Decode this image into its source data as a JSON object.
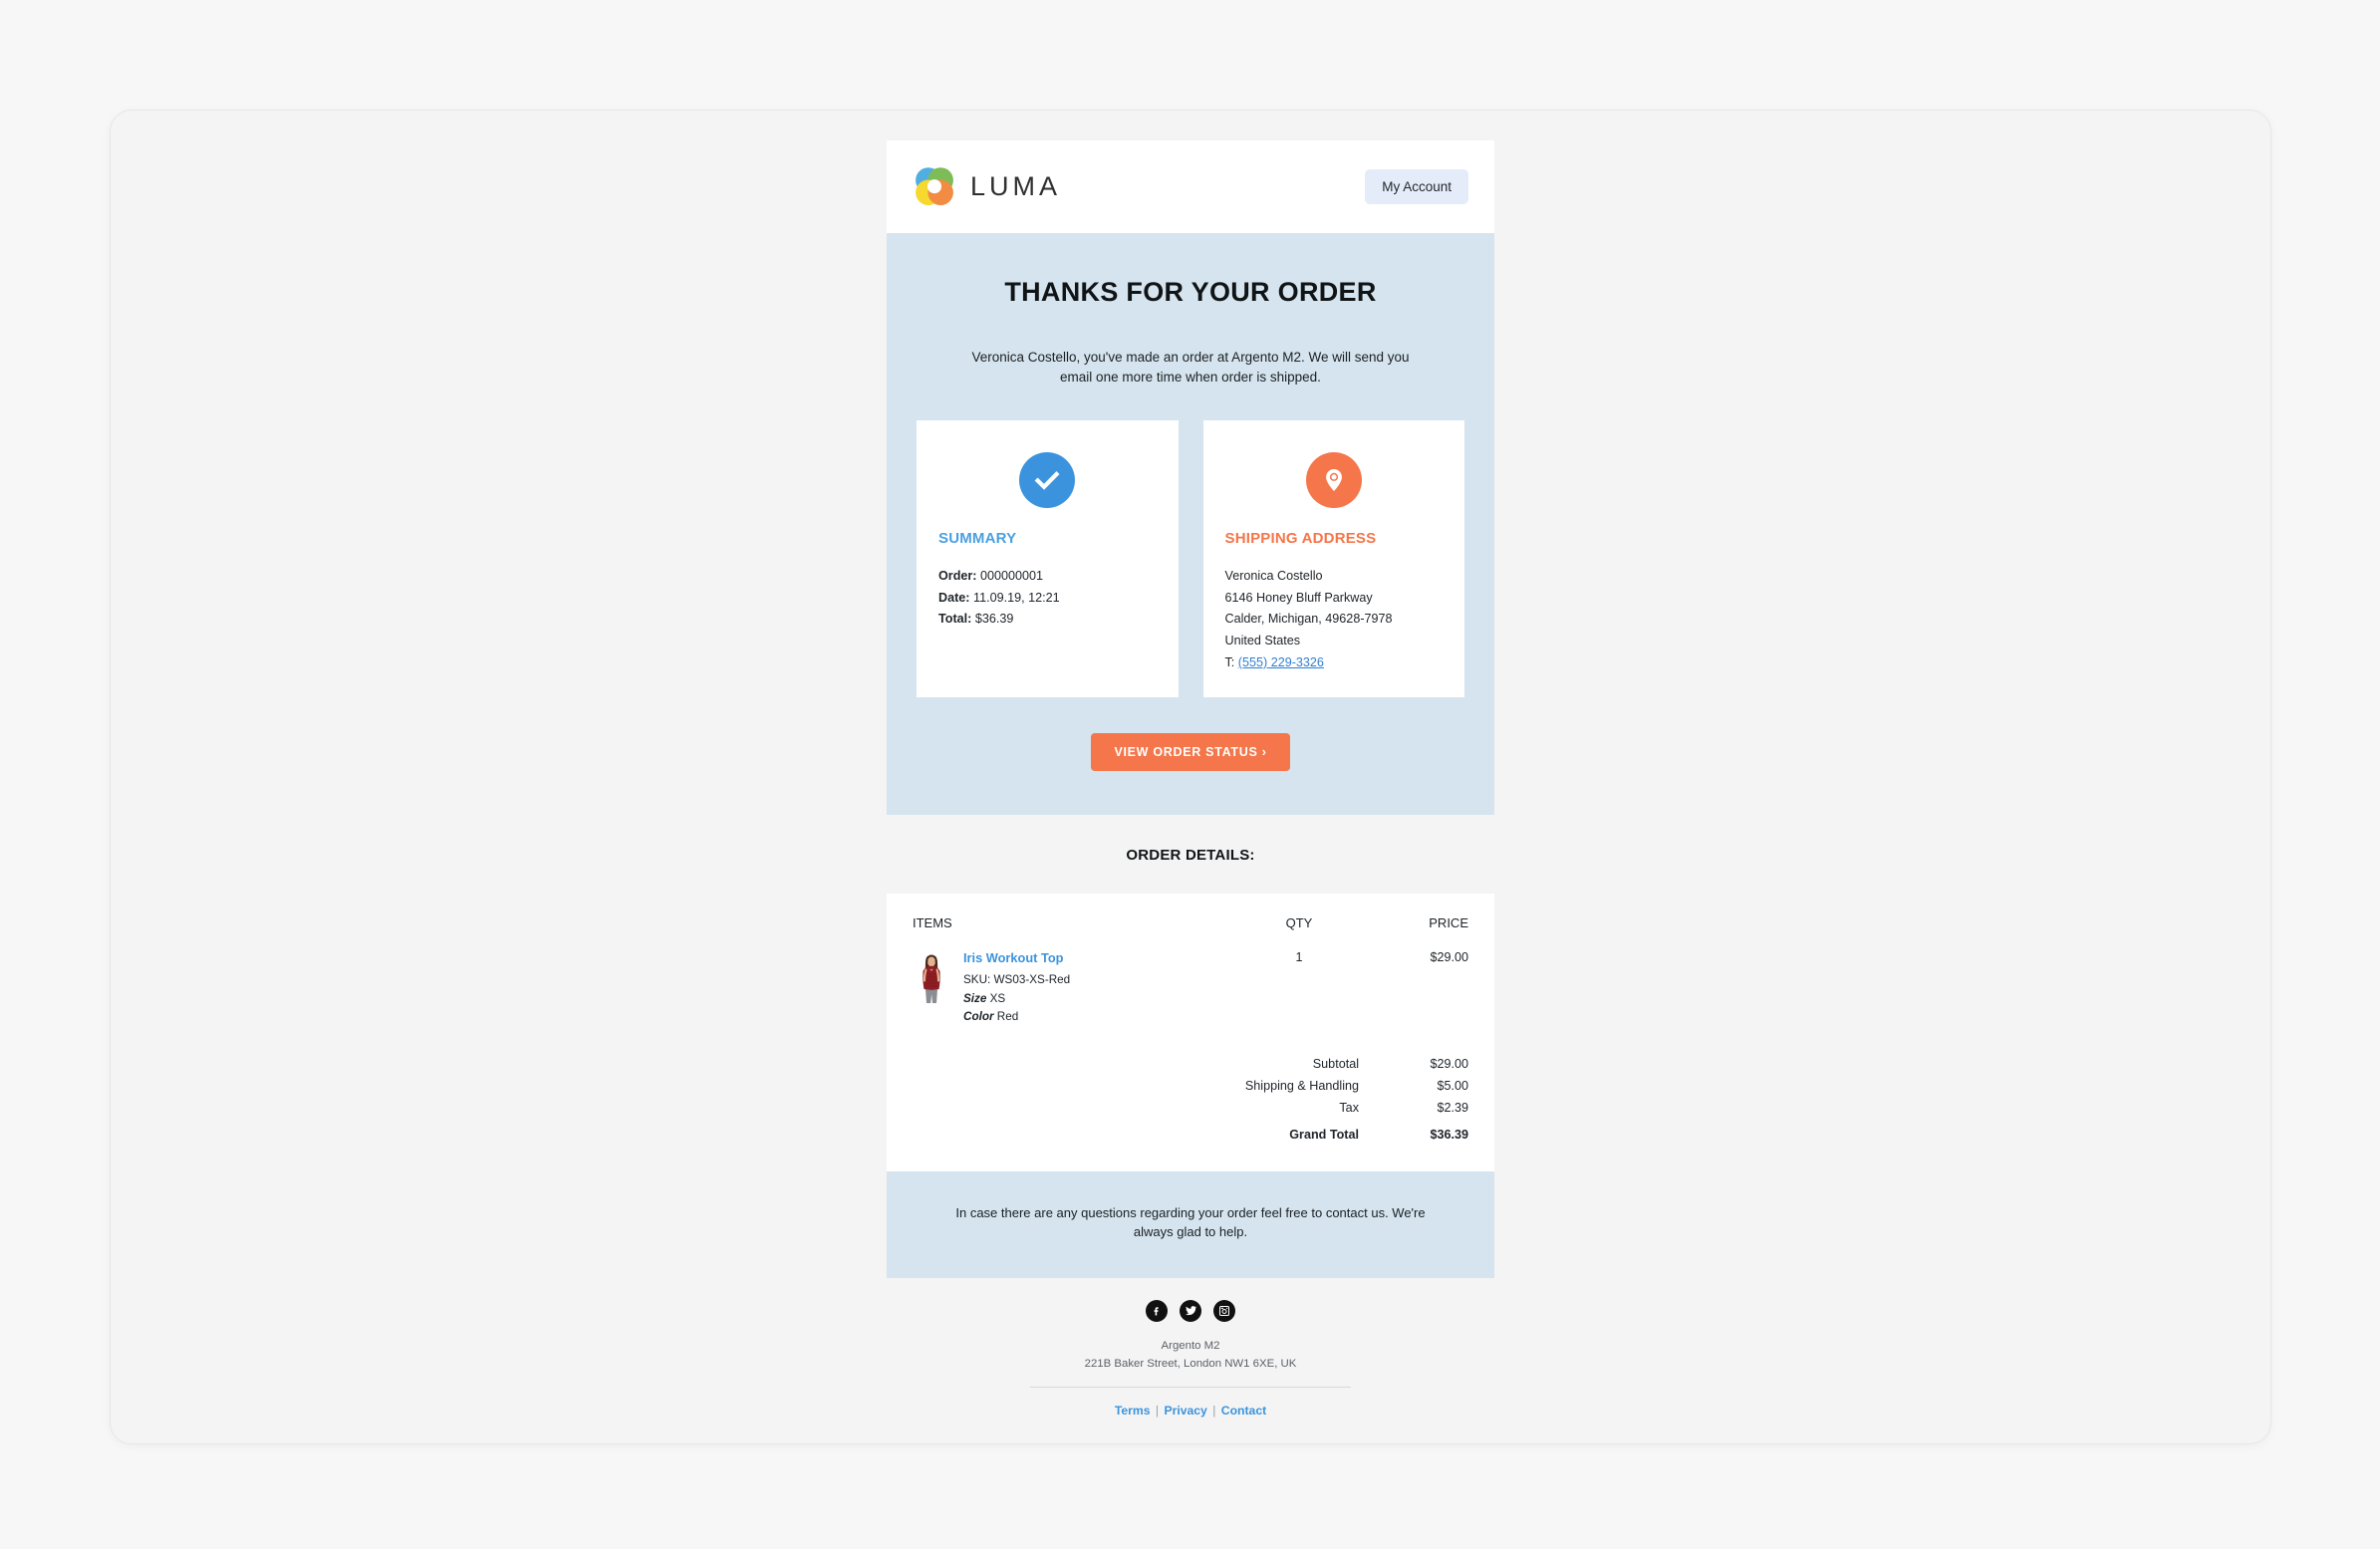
{
  "header": {
    "brand_name": "LUMA",
    "logo_icon": "luma-ring-logo",
    "account_button": "My Account"
  },
  "hero": {
    "title": "THANKS FOR YOUR ORDER",
    "subtitle": "Veronica Costello, you've made an order at Argento M2. We will send you email one more time when order is shipped.",
    "cta_label": "VIEW ORDER STATUS ›",
    "background_color": "#d5e4ee"
  },
  "summary_card": {
    "icon": "check-circle-icon",
    "icon_color": "#3b93dd",
    "title": "SUMMARY",
    "order_label": "Order:",
    "order_value": "000000001",
    "date_label": "Date:",
    "date_value": "11.09.19, 12:21",
    "total_label": "Total:",
    "total_value": "$36.39"
  },
  "shipping_card": {
    "icon": "location-pin-icon",
    "icon_color": "#f4764a",
    "title": "SHIPPING ADDRESS",
    "name": "Veronica Costello",
    "street": "6146 Honey Bluff Parkway",
    "city_state_zip": "Calder, Michigan, 49628-7978",
    "country": "United States",
    "phone_label": "T:",
    "phone": "(555) 229-3326"
  },
  "order_details": {
    "heading": "ORDER DETAILS:",
    "columns": {
      "items": "ITEMS",
      "qty": "QTY",
      "price": "PRICE"
    },
    "items": [
      {
        "name": "Iris Workout Top",
        "sku_label": "SKU:",
        "sku_value": "WS03-XS-Red",
        "size_label": "Size",
        "size_value": "XS",
        "color_label": "Color",
        "color_value": "Red",
        "qty": "1",
        "price": "$29.00",
        "thumbnail": "product-thumbnail-iris-workout-top"
      }
    ],
    "totals": [
      {
        "label": "Subtotal",
        "value": "$29.00"
      },
      {
        "label": "Shipping & Handling",
        "value": "$5.00"
      },
      {
        "label": "Tax",
        "value": "$2.39"
      }
    ],
    "grand_total": {
      "label": "Grand Total",
      "value": "$36.39"
    }
  },
  "help_note": "In case there are any questions regarding your order feel free to contact us. We're always glad to help.",
  "footer": {
    "socials": [
      {
        "name": "facebook-icon"
      },
      {
        "name": "twitter-icon"
      },
      {
        "name": "instagram-icon"
      }
    ],
    "company": "Argento M2",
    "address": "221B Baker Street, London NW1 6XE, UK",
    "links": [
      {
        "label": "Terms"
      },
      {
        "label": "Privacy"
      },
      {
        "label": "Contact"
      }
    ],
    "separator": "|"
  }
}
